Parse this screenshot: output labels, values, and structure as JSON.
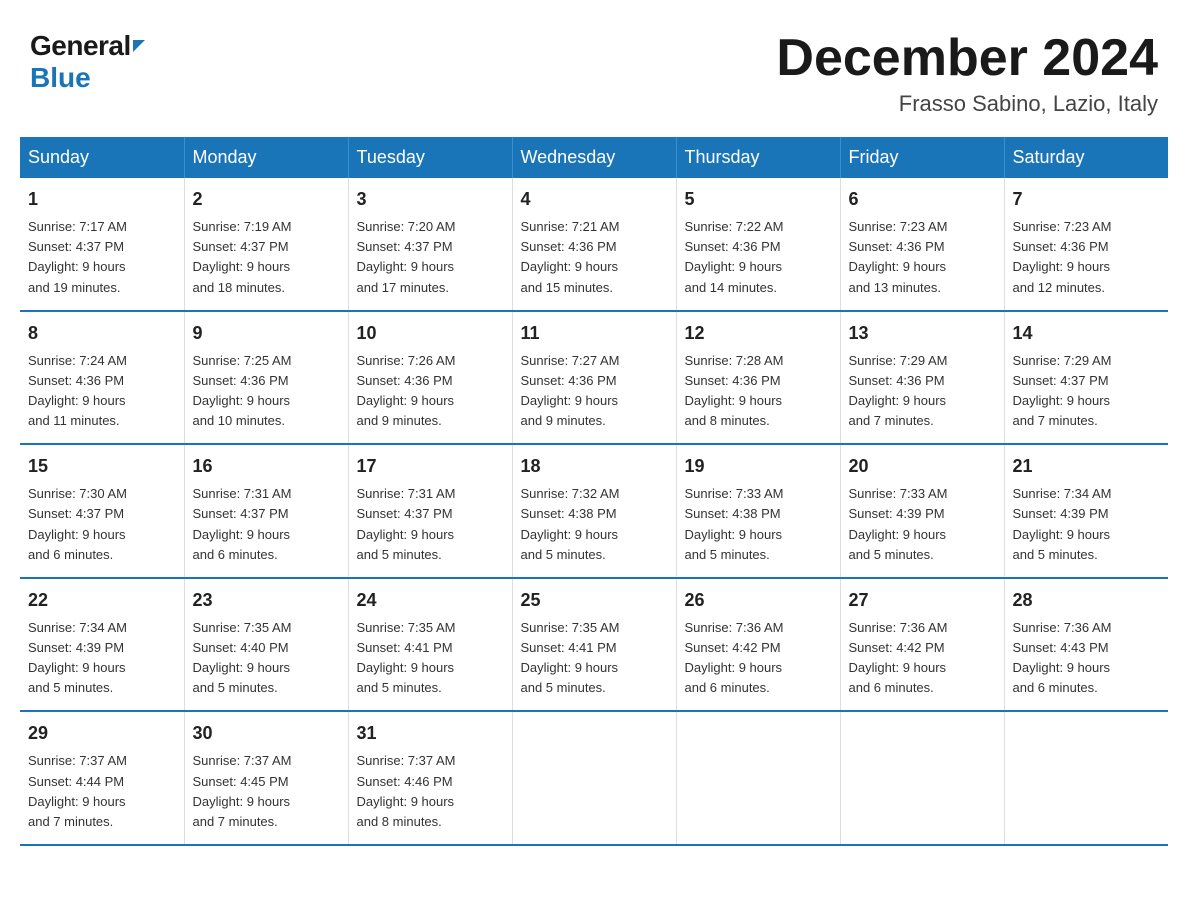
{
  "logo": {
    "general": "General",
    "blue": "Blue"
  },
  "title": {
    "month": "December 2024",
    "location": "Frasso Sabino, Lazio, Italy"
  },
  "days_of_week": [
    "Sunday",
    "Monday",
    "Tuesday",
    "Wednesday",
    "Thursday",
    "Friday",
    "Saturday"
  ],
  "weeks": [
    [
      {
        "day": "1",
        "sunrise": "7:17 AM",
        "sunset": "4:37 PM",
        "daylight": "9 hours and 19 minutes."
      },
      {
        "day": "2",
        "sunrise": "7:19 AM",
        "sunset": "4:37 PM",
        "daylight": "9 hours and 18 minutes."
      },
      {
        "day": "3",
        "sunrise": "7:20 AM",
        "sunset": "4:37 PM",
        "daylight": "9 hours and 17 minutes."
      },
      {
        "day": "4",
        "sunrise": "7:21 AM",
        "sunset": "4:36 PM",
        "daylight": "9 hours and 15 minutes."
      },
      {
        "day": "5",
        "sunrise": "7:22 AM",
        "sunset": "4:36 PM",
        "daylight": "9 hours and 14 minutes."
      },
      {
        "day": "6",
        "sunrise": "7:23 AM",
        "sunset": "4:36 PM",
        "daylight": "9 hours and 13 minutes."
      },
      {
        "day": "7",
        "sunrise": "7:23 AM",
        "sunset": "4:36 PM",
        "daylight": "9 hours and 12 minutes."
      }
    ],
    [
      {
        "day": "8",
        "sunrise": "7:24 AM",
        "sunset": "4:36 PM",
        "daylight": "9 hours and 11 minutes."
      },
      {
        "day": "9",
        "sunrise": "7:25 AM",
        "sunset": "4:36 PM",
        "daylight": "9 hours and 10 minutes."
      },
      {
        "day": "10",
        "sunrise": "7:26 AM",
        "sunset": "4:36 PM",
        "daylight": "9 hours and 9 minutes."
      },
      {
        "day": "11",
        "sunrise": "7:27 AM",
        "sunset": "4:36 PM",
        "daylight": "9 hours and 9 minutes."
      },
      {
        "day": "12",
        "sunrise": "7:28 AM",
        "sunset": "4:36 PM",
        "daylight": "9 hours and 8 minutes."
      },
      {
        "day": "13",
        "sunrise": "7:29 AM",
        "sunset": "4:36 PM",
        "daylight": "9 hours and 7 minutes."
      },
      {
        "day": "14",
        "sunrise": "7:29 AM",
        "sunset": "4:37 PM",
        "daylight": "9 hours and 7 minutes."
      }
    ],
    [
      {
        "day": "15",
        "sunrise": "7:30 AM",
        "sunset": "4:37 PM",
        "daylight": "9 hours and 6 minutes."
      },
      {
        "day": "16",
        "sunrise": "7:31 AM",
        "sunset": "4:37 PM",
        "daylight": "9 hours and 6 minutes."
      },
      {
        "day": "17",
        "sunrise": "7:31 AM",
        "sunset": "4:37 PM",
        "daylight": "9 hours and 5 minutes."
      },
      {
        "day": "18",
        "sunrise": "7:32 AM",
        "sunset": "4:38 PM",
        "daylight": "9 hours and 5 minutes."
      },
      {
        "day": "19",
        "sunrise": "7:33 AM",
        "sunset": "4:38 PM",
        "daylight": "9 hours and 5 minutes."
      },
      {
        "day": "20",
        "sunrise": "7:33 AM",
        "sunset": "4:39 PM",
        "daylight": "9 hours and 5 minutes."
      },
      {
        "day": "21",
        "sunrise": "7:34 AM",
        "sunset": "4:39 PM",
        "daylight": "9 hours and 5 minutes."
      }
    ],
    [
      {
        "day": "22",
        "sunrise": "7:34 AM",
        "sunset": "4:39 PM",
        "daylight": "9 hours and 5 minutes."
      },
      {
        "day": "23",
        "sunrise": "7:35 AM",
        "sunset": "4:40 PM",
        "daylight": "9 hours and 5 minutes."
      },
      {
        "day": "24",
        "sunrise": "7:35 AM",
        "sunset": "4:41 PM",
        "daylight": "9 hours and 5 minutes."
      },
      {
        "day": "25",
        "sunrise": "7:35 AM",
        "sunset": "4:41 PM",
        "daylight": "9 hours and 5 minutes."
      },
      {
        "day": "26",
        "sunrise": "7:36 AM",
        "sunset": "4:42 PM",
        "daylight": "9 hours and 6 minutes."
      },
      {
        "day": "27",
        "sunrise": "7:36 AM",
        "sunset": "4:42 PM",
        "daylight": "9 hours and 6 minutes."
      },
      {
        "day": "28",
        "sunrise": "7:36 AM",
        "sunset": "4:43 PM",
        "daylight": "9 hours and 6 minutes."
      }
    ],
    [
      {
        "day": "29",
        "sunrise": "7:37 AM",
        "sunset": "4:44 PM",
        "daylight": "9 hours and 7 minutes."
      },
      {
        "day": "30",
        "sunrise": "7:37 AM",
        "sunset": "4:45 PM",
        "daylight": "9 hours and 7 minutes."
      },
      {
        "day": "31",
        "sunrise": "7:37 AM",
        "sunset": "4:46 PM",
        "daylight": "9 hours and 8 minutes."
      },
      null,
      null,
      null,
      null
    ]
  ]
}
